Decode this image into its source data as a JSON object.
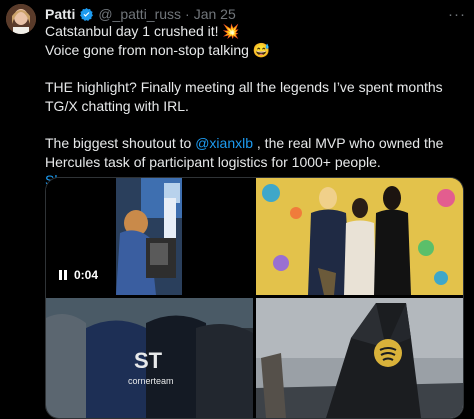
{
  "author": {
    "name": "Patti",
    "handle": "@_patti_russ",
    "separator": "·",
    "date": "Jan 25",
    "verified_color": "#1d9bf0"
  },
  "tweet": {
    "line1": "Catstanbul day 1 crushed it! 💥",
    "line2": "Voice gone from non-stop talking 😅",
    "para2": "THE highlight? Finally meeting all the legends I’ve spent months TG/X chatting with IRL.",
    "para3_pre": "The biggest shoutout to ",
    "mention": "@xianxlb",
    "para3_post": " , the real MVP who owned the Hercules task of participant logistics for 1000+ people.",
    "show_more": "Show more"
  },
  "more_menu": "···",
  "media": {
    "video_time": "0:04",
    "tile3_logo_text": "cornerteam"
  },
  "colors": {
    "background": "#000000",
    "text": "#e7e9ea",
    "muted": "#71767b",
    "link": "#1d9bf0"
  }
}
